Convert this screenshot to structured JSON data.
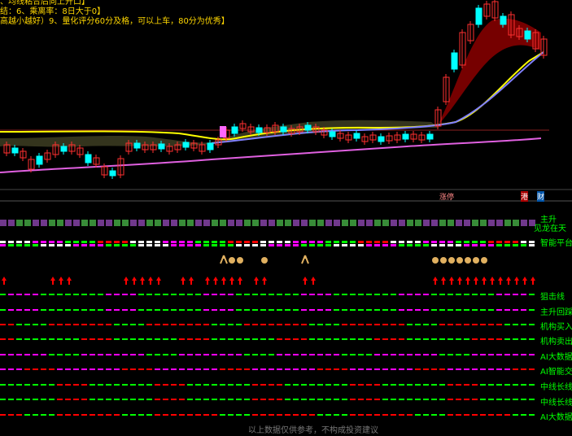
{
  "header": {
    "line1": "、均线粘合后向上开口】",
    "line2": "结：6、乘离率：8日大于0】",
    "line3": "高越小越好）9、量化评分60分及格，可以上车，80分为优秀】"
  },
  "bottom_tags": {
    "t1": "涨停",
    "t2": "港",
    "t3": "财"
  },
  "right_labels": [
    "主升",
    "见龙在天",
    "智能平台",
    "狙击线",
    "主升回踩",
    "机构买入",
    "机构卖出",
    "AI大数据",
    "AI智能交",
    "中线长线",
    "中线长线",
    "AI大数据"
  ],
  "footer_text": "以上数据仅供参考，不构成投资建议",
  "colors": {
    "up": "#ff3030",
    "down": "#00ffff",
    "magenta": "#ff00ff",
    "green": "#00ff00",
    "red": "#ff0000",
    "yellow": "#ffff00",
    "white": "#ffffff",
    "gold": "#ffd700"
  },
  "icons": {
    "bag": "money-bag-icon",
    "person": "person-icon",
    "arrow": "up-arrow-icon"
  }
}
